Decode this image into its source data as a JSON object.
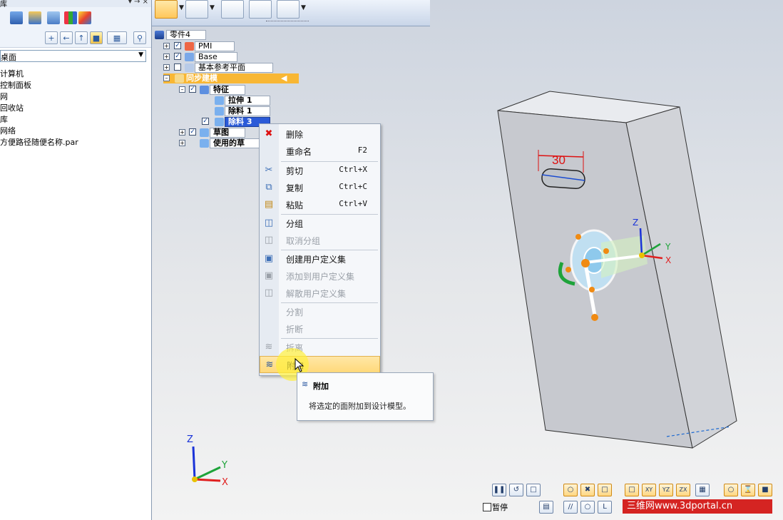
{
  "left_panel": {
    "title": "库",
    "pin_icons": "▾ → ×",
    "combo_value": "桌面",
    "items": [
      "计算机",
      "控制面板",
      "网",
      "回收站",
      "库",
      "网络",
      "方便路径随便名称.par"
    ]
  },
  "tree": {
    "root": "零件4",
    "pmi": "PMI",
    "base": "Base",
    "ref_planes": "基本参考平面",
    "sync": "同步建模",
    "features": "特征",
    "extrude1": "拉伸 1",
    "cut1": "除料 1",
    "cut3": "除料 3",
    "sketches": "草图",
    "used_sketches": "使用的草"
  },
  "context_menu": {
    "items": [
      {
        "label": "删除",
        "shortcut": "",
        "icon": "delete-icon",
        "disabled": false
      },
      {
        "label": "重命名",
        "shortcut": "F2",
        "icon": "",
        "disabled": false
      },
      {
        "label": "剪切",
        "shortcut": "Ctrl+X",
        "icon": "cut-icon",
        "disabled": false
      },
      {
        "label": "复制",
        "shortcut": "Ctrl+C",
        "icon": "copy-icon",
        "disabled": false
      },
      {
        "label": "粘贴",
        "shortcut": "Ctrl+V",
        "icon": "paste-icon",
        "disabled": false
      },
      {
        "label": "分组",
        "shortcut": "",
        "icon": "group-icon",
        "disabled": false
      },
      {
        "label": "取消分组",
        "shortcut": "",
        "icon": "ungroup-icon",
        "disabled": true
      },
      {
        "label": "创建用户定义集",
        "shortcut": "",
        "icon": "create-set-icon",
        "disabled": false
      },
      {
        "label": "添加到用户定义集",
        "shortcut": "",
        "icon": "add-set-icon",
        "disabled": true
      },
      {
        "label": "解散用户定义集",
        "shortcut": "",
        "icon": "dissolve-set-icon",
        "disabled": true
      },
      {
        "label": "分割",
        "shortcut": "",
        "icon": "",
        "disabled": true
      },
      {
        "label": "折断",
        "shortcut": "",
        "icon": "",
        "disabled": true
      },
      {
        "label": "拆离",
        "shortcut": "",
        "icon": "detach-icon",
        "disabled": true
      },
      {
        "label": "附加",
        "shortcut": "",
        "icon": "attach-icon",
        "disabled": false,
        "highlighted": true
      }
    ]
  },
  "tooltip": {
    "title": "附加",
    "body": "将选定的面附加到设计模型。"
  },
  "model": {
    "dimension": "30",
    "axis_x": "X",
    "axis_y": "Y",
    "axis_z": "Z"
  },
  "bottom": {
    "pause_label": "暂停",
    "watermark": "三维网www.3dportal.cn",
    "view_labels": [
      "XY",
      "YZ",
      "ZX"
    ]
  }
}
